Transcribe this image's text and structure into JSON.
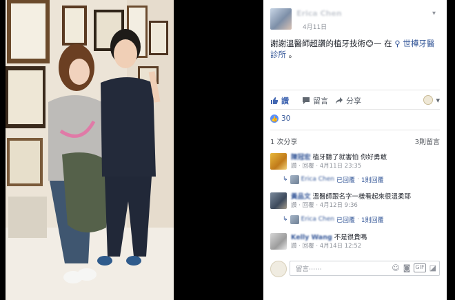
{
  "post": {
    "author_name": "Erica Chen",
    "date": "4月11日",
    "text_before": "謝謝溫醫師超讚的植牙技術😊— 在",
    "location": "世樺牙醫診所",
    "text_after": "。"
  },
  "actions": {
    "like": "讚",
    "comment": "留言",
    "share": "分享"
  },
  "reactions": {
    "count": "30"
  },
  "stats": {
    "shares": "1 次分享",
    "comments": "3則留言"
  },
  "comments": [
    {
      "author": "陳冠宏",
      "text": "植牙聽了就害怕 你好勇敢",
      "like_label": "讚",
      "reply_label": "回覆",
      "time": "4月11日 23:35",
      "reply_author": "Erica Chen",
      "reply_text": "已回覆",
      "reply_count": "1則回覆"
    },
    {
      "author": "黃品文",
      "text": "溫醫師跟名字一樣看起來很溫柔耶",
      "like_label": "讚",
      "reply_label": "回覆",
      "time": "4月12日 9:36",
      "reply_author": "Erica Chen",
      "reply_text": "已回覆",
      "reply_count": "1則回覆"
    },
    {
      "author": "Kelly Wang",
      "text": "不是很貴嗎",
      "like_label": "讚",
      "reply_label": "回覆",
      "time": "4月14日 12:52"
    }
  ],
  "input": {
    "placeholder": "留言⋯⋯"
  },
  "colors": {
    "link": "#365899",
    "like_blue": "#5890ff",
    "meta_gray": "#90949c"
  }
}
